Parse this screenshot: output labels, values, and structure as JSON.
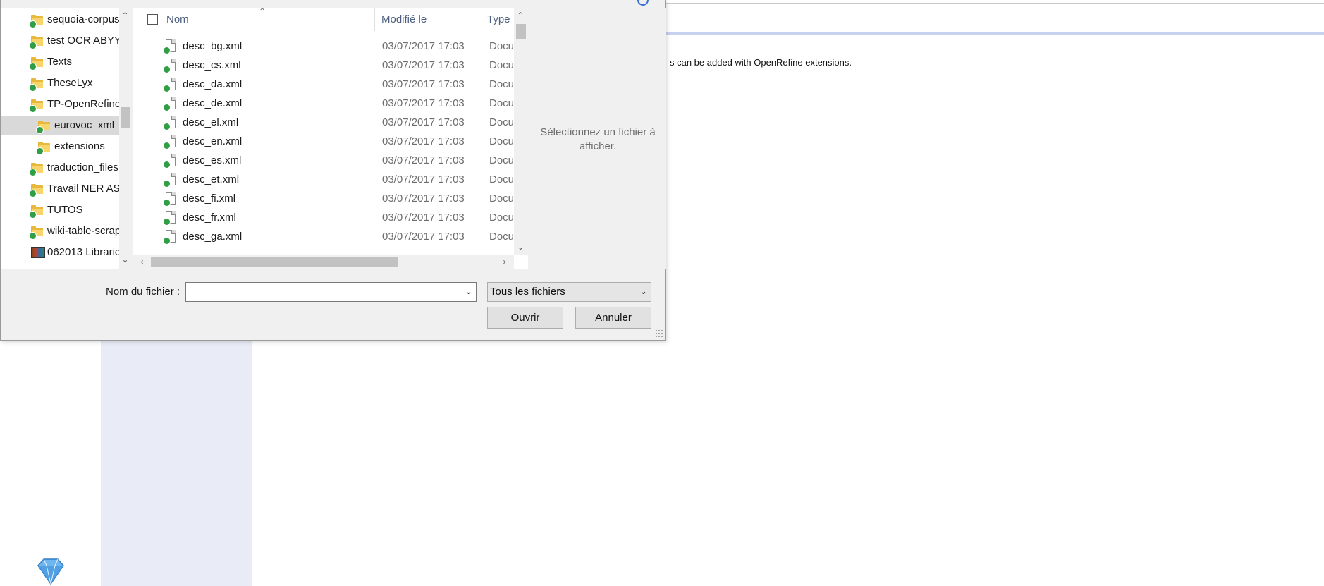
{
  "background": {
    "notice_text": "s can be added with OpenRefine extensions."
  },
  "dialog": {
    "nav": {
      "items": [
        {
          "label": "sequoia-corpus",
          "icon": "folder-icon",
          "indent": 0
        },
        {
          "label": "test OCR ABYYY",
          "icon": "folder-icon",
          "indent": 0
        },
        {
          "label": "Texts",
          "icon": "folder-icon",
          "indent": 0
        },
        {
          "label": "TheseLyx",
          "icon": "folder-icon",
          "indent": 0
        },
        {
          "label": "TP-OpenRefine",
          "icon": "folder-icon",
          "indent": 0
        },
        {
          "label": "eurovoc_xml",
          "icon": "folder-icon",
          "indent": 1,
          "selected": true
        },
        {
          "label": "extensions",
          "icon": "folder-icon",
          "indent": 1
        },
        {
          "label": "traduction_files",
          "icon": "folder-icon",
          "indent": 0
        },
        {
          "label": "Travail NER ASI",
          "icon": "folder-icon",
          "indent": 0
        },
        {
          "label": "TUTOS",
          "icon": "folder-icon",
          "indent": 0
        },
        {
          "label": "wiki-table-scrap",
          "icon": "folder-icon",
          "indent": 0
        },
        {
          "label": "062013 Librarie",
          "icon": "library-book-icon",
          "indent": 0
        }
      ]
    },
    "columns": {
      "name": "Nom",
      "modified": "Modifié le",
      "type": "Type"
    },
    "files": [
      {
        "name": "desc_bg.xml",
        "date": "03/07/2017 17:03",
        "type": "Docu"
      },
      {
        "name": "desc_cs.xml",
        "date": "03/07/2017 17:03",
        "type": "Docu"
      },
      {
        "name": "desc_da.xml",
        "date": "03/07/2017 17:03",
        "type": "Docu"
      },
      {
        "name": "desc_de.xml",
        "date": "03/07/2017 17:03",
        "type": "Docu"
      },
      {
        "name": "desc_el.xml",
        "date": "03/07/2017 17:03",
        "type": "Docu"
      },
      {
        "name": "desc_en.xml",
        "date": "03/07/2017 17:03",
        "type": "Docu"
      },
      {
        "name": "desc_es.xml",
        "date": "03/07/2017 17:03",
        "type": "Docu"
      },
      {
        "name": "desc_et.xml",
        "date": "03/07/2017 17:03",
        "type": "Docu"
      },
      {
        "name": "desc_fi.xml",
        "date": "03/07/2017 17:03",
        "type": "Docu"
      },
      {
        "name": "desc_fr.xml",
        "date": "03/07/2017 17:03",
        "type": "Docu"
      },
      {
        "name": "desc_ga.xml",
        "date": "03/07/2017 17:03",
        "type": "Docu"
      }
    ],
    "preview_text": "Sélectionnez un fichier à afficher.",
    "filename_label": "Nom du fichier :",
    "filename_value": "",
    "filter_value": "Tous les fichiers",
    "open_label": "Ouvrir",
    "cancel_label": "Annuler",
    "colors": {
      "accent_blue": "#c6d2ef",
      "badge_green": "#2f9e44",
      "folder_yellow": "#f7d56b"
    }
  }
}
